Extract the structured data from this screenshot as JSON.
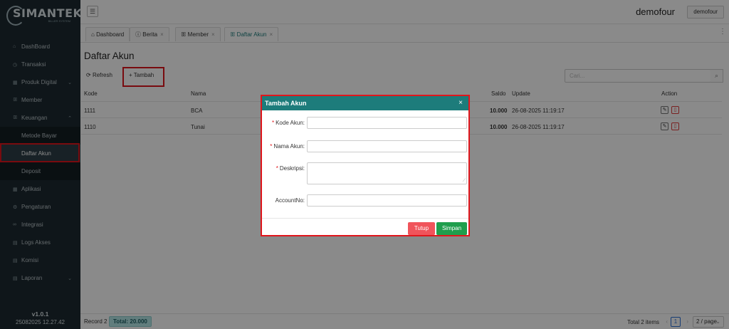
{
  "brand": {
    "name": "SIMANTEK",
    "tagline": "BILLER SYSTEM"
  },
  "sidebar": {
    "items": [
      {
        "label": "DashBoard",
        "icon": "home-icon"
      },
      {
        "label": "Transaksi",
        "icon": "clock-icon"
      },
      {
        "label": "Produk Digital",
        "icon": "grid-icon"
      },
      {
        "label": "Member",
        "icon": "users-icon"
      },
      {
        "label": "Keuangan",
        "icon": "users-icon"
      },
      {
        "label": "Metode Bayar"
      },
      {
        "label": "Daftar Akun"
      },
      {
        "label": "Deposit"
      },
      {
        "label": "Aplikasi",
        "icon": "grid-icon"
      },
      {
        "label": "Pengaturan",
        "icon": "gear-icon"
      },
      {
        "label": "Integrasi",
        "icon": "link-icon"
      },
      {
        "label": "Logs Akses",
        "icon": "doc-icon"
      },
      {
        "label": "Komisi",
        "icon": "doc-icon"
      },
      {
        "label": "Laporan",
        "icon": "doc-icon"
      }
    ],
    "version": "v1.0.1",
    "build": "25082025 12.27.42"
  },
  "topbar": {
    "menu_icon": "☰",
    "username": "demofour",
    "user_button": "demofour"
  },
  "tabs": [
    {
      "label": "Dashboard",
      "icon": "⌂"
    },
    {
      "label": "Berita",
      "icon": "ⓘ",
      "close": "×"
    },
    {
      "label": "Member",
      "icon": "ꕥ",
      "close": "×"
    },
    {
      "label": "Daftar Akun",
      "icon": "ꕥ",
      "close": "×"
    }
  ],
  "page": {
    "title": "Daftar Akun"
  },
  "toolbar": {
    "refresh": "Refresh",
    "add": "Tambah",
    "search_placeholder": "Cari..."
  },
  "table": {
    "headers": {
      "kode": "Kode",
      "nama": "Nama",
      "saldo": "Saldo",
      "update": "Update",
      "action": "Action"
    },
    "rows": [
      {
        "kode": "1111",
        "nama": "BCA",
        "saldo": "10.000",
        "update": "26-08-2025 11:19:17"
      },
      {
        "kode": "1110",
        "nama": "Tunai",
        "saldo": "10.000",
        "update": "26-08-2025 11:19:17"
      }
    ]
  },
  "footer": {
    "record": "Record 2",
    "total": "Total: 20.000",
    "total_items": "Total 2 items",
    "page": "1",
    "page_size": "2 / page"
  },
  "modal": {
    "title": "Tambah Akun",
    "close": "×",
    "fields": {
      "kode": "Kode Akun:",
      "nama": "Nama Akun:",
      "deskripsi": "Deskripsi:",
      "account_no": "AccountNo:"
    },
    "buttons": {
      "close": "Tutup",
      "save": "Simpan"
    }
  },
  "colors": {
    "accent": "#1d7c7b",
    "sidebar": "#1d2a30",
    "danger": "#f0545b",
    "success": "#1f9e4d",
    "highlight": "#e0161c"
  }
}
